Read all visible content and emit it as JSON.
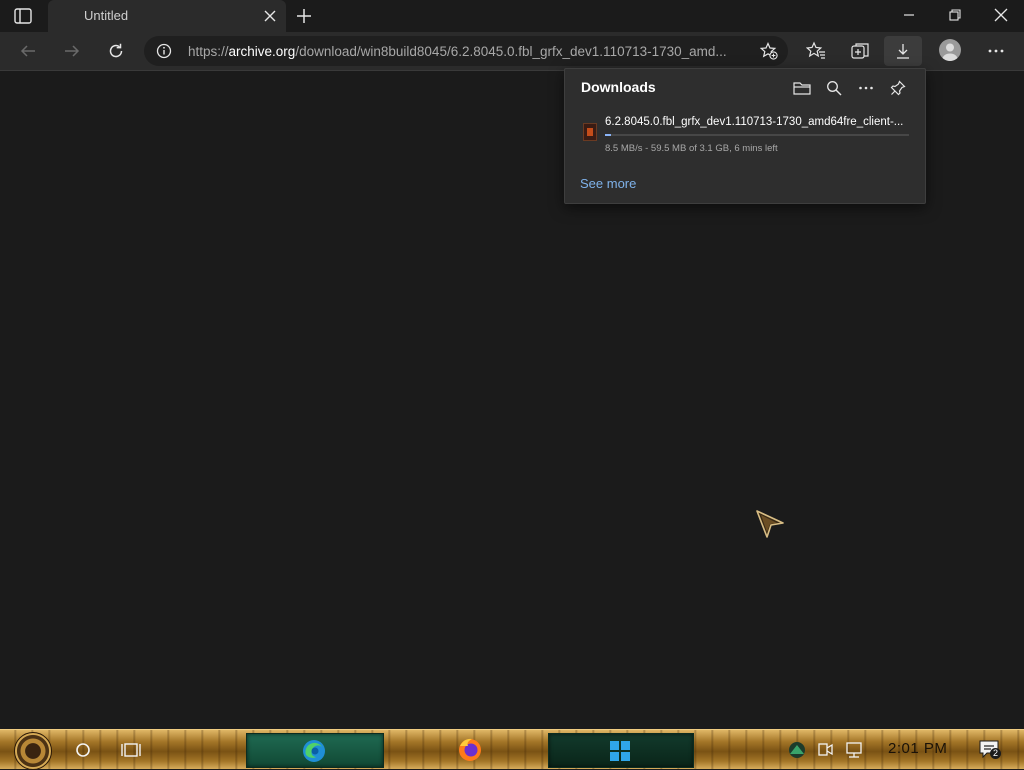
{
  "browser": {
    "tab": {
      "title": "Untitled"
    },
    "address": {
      "url_scheme": "https://",
      "url_host": "archive.org",
      "url_path": "/download/win8build8045/6.2.8045.0.fbl_grfx_dev1.110713-1730_amd..."
    }
  },
  "downloads": {
    "title": "Downloads",
    "items": [
      {
        "filename": "6.2.8045.0.fbl_grfx_dev1.110713-1730_amd64fre_client-...",
        "status": "8.5 MB/s - 59.5 MB of 3.1 GB, 6 mins left",
        "progress": 0.019
      }
    ],
    "see_more": "See more"
  },
  "taskbar": {
    "clock": "2:01 PM",
    "notification_count": "2",
    "apps": [
      "Microsoft Edge",
      "Firefox",
      "Microsoft Store"
    ]
  },
  "colors": {
    "accent": "#8ab4f8",
    "link": "#7fb2ea",
    "page_bg": "#1b1b1b",
    "toolbar_bg": "#2b2b2b"
  }
}
